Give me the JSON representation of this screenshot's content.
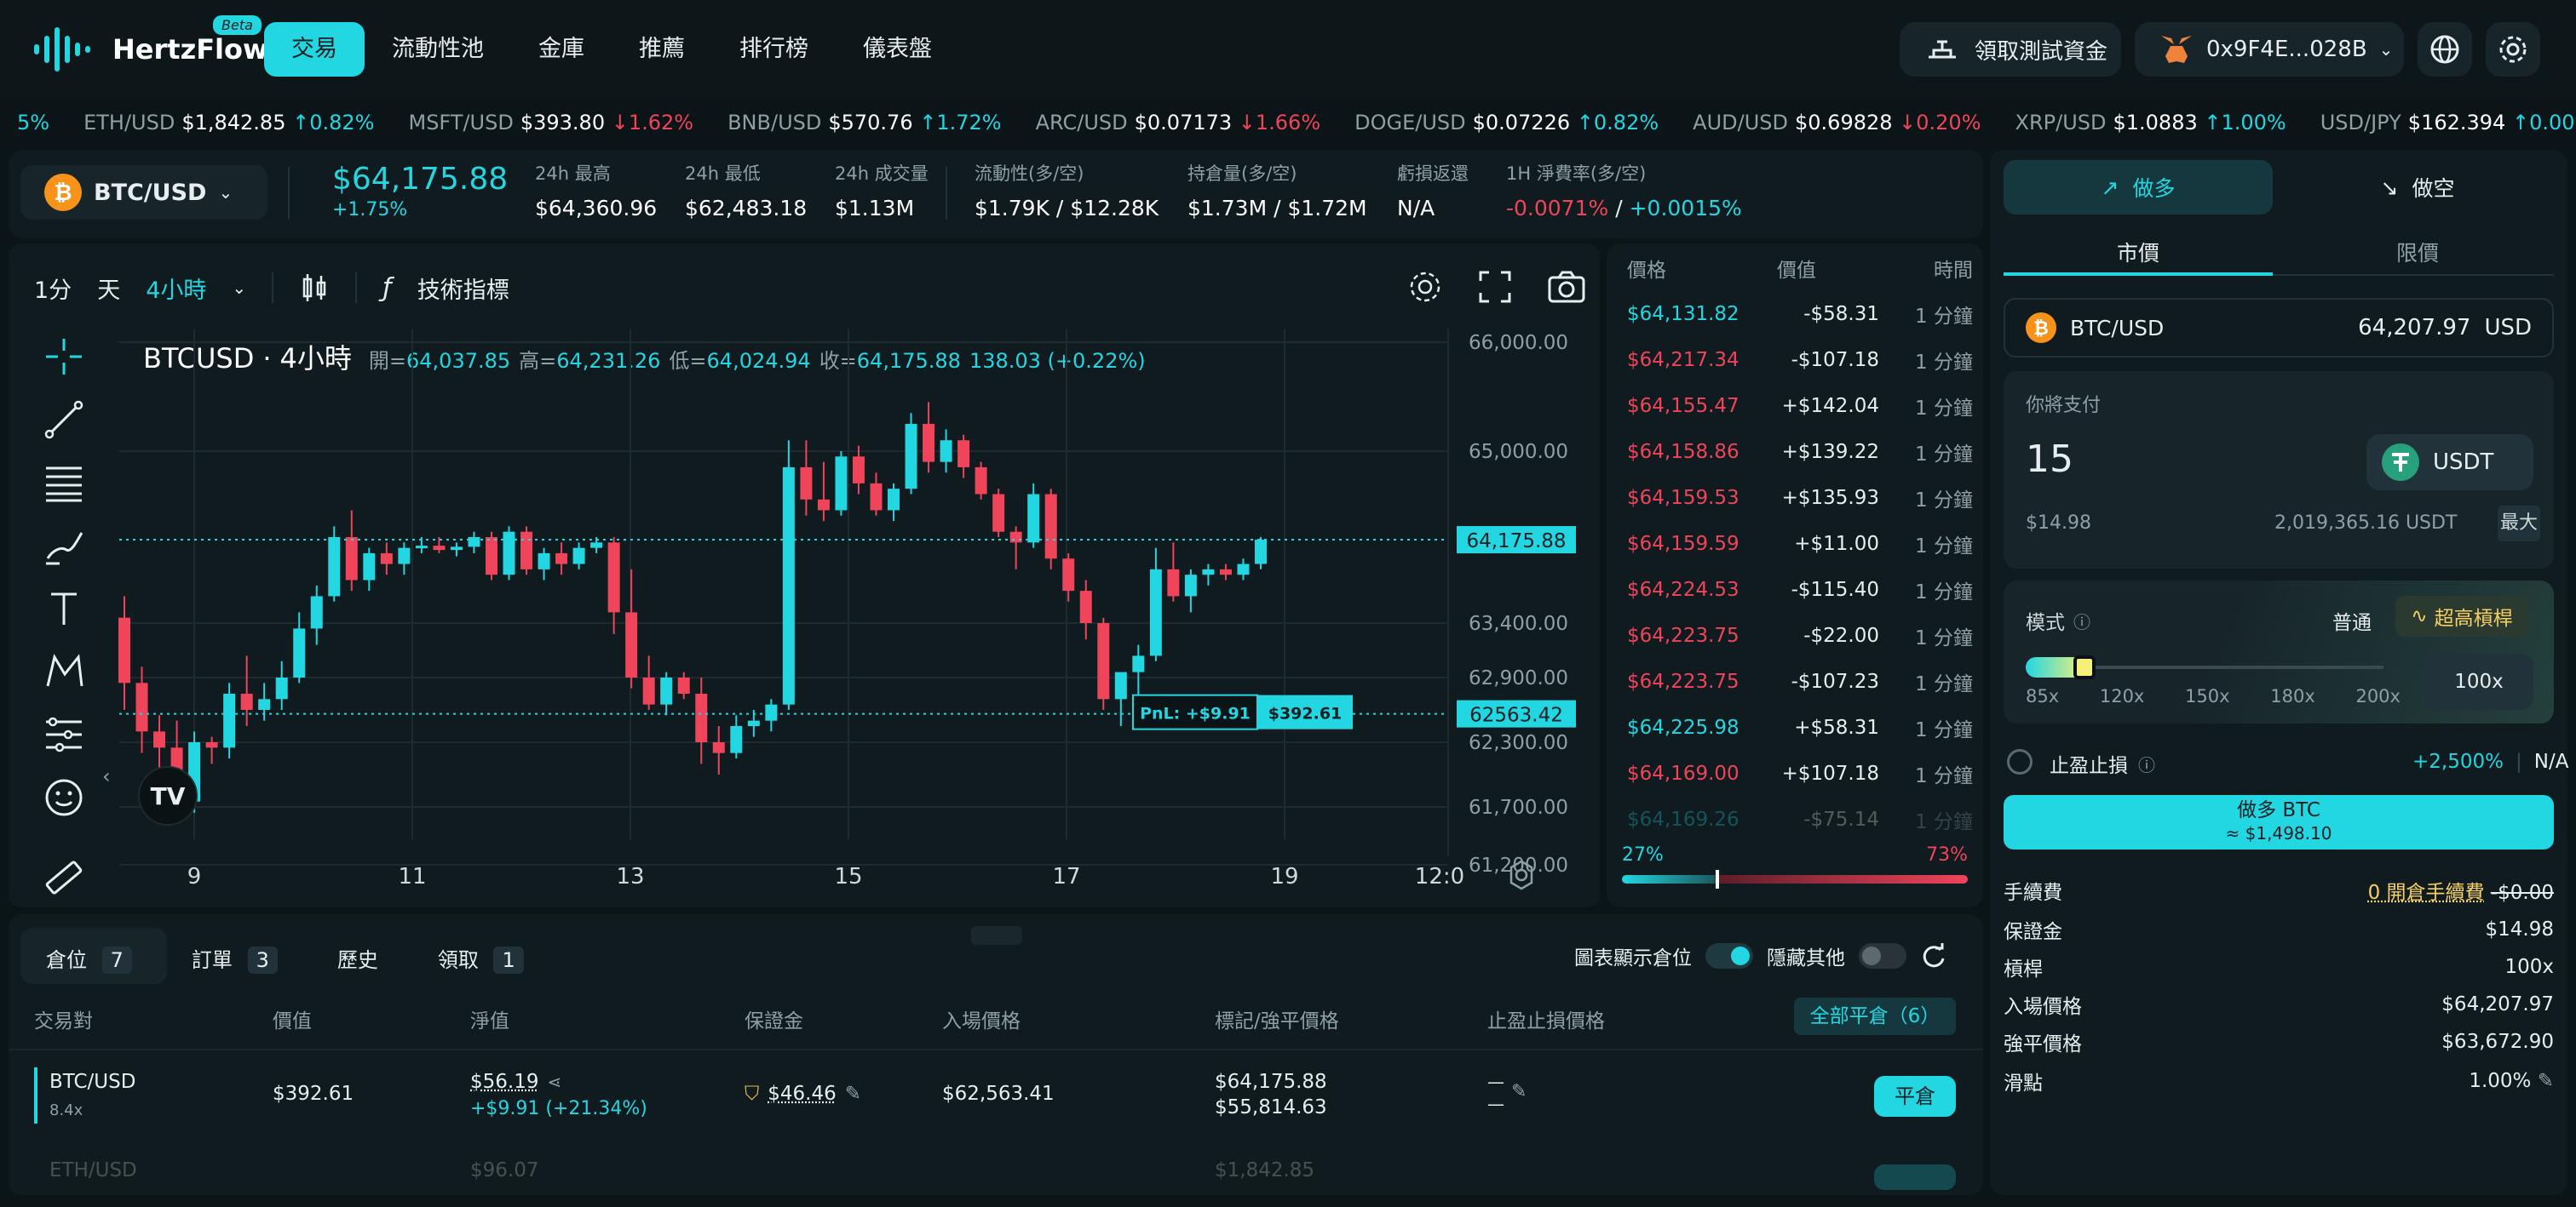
{
  "brand": {
    "name": "HertzFlow",
    "badge": "Beta"
  },
  "nav": {
    "items": [
      "交易",
      "流動性池",
      "金庫",
      "推薦",
      "排行榜",
      "儀表盤"
    ],
    "faucet": "領取測試資金",
    "wallet": "0x9F4E...028B"
  },
  "ticker": [
    {
      "sym": "",
      "price": "",
      "chg": "5%",
      "dir": "up"
    },
    {
      "sym": "ETH/USD",
      "price": "$1,842.85",
      "chg": "↑0.82%",
      "dir": "up"
    },
    {
      "sym": "MSFT/USD",
      "price": "$393.80",
      "chg": "↓1.62%",
      "dir": "dn"
    },
    {
      "sym": "BNB/USD",
      "price": "$570.76",
      "chg": "↑1.72%",
      "dir": "up"
    },
    {
      "sym": "ARC/USD",
      "price": "$0.07173",
      "chg": "↓1.66%",
      "dir": "dn"
    },
    {
      "sym": "DOGE/USD",
      "price": "$0.07226",
      "chg": "↑0.82%",
      "dir": "up"
    },
    {
      "sym": "AUD/USD",
      "price": "$0.69828",
      "chg": "↓0.20%",
      "dir": "dn"
    },
    {
      "sym": "XRP/USD",
      "price": "$1.0883",
      "chg": "↑1.00%",
      "dir": "up"
    },
    {
      "sym": "USD/JPY",
      "price": "$162.394",
      "chg": "↑0.00%",
      "dir": "up"
    }
  ],
  "market": {
    "pair": "BTC/USD",
    "price": "$64,175.88",
    "change": "+1.75%",
    "stats": [
      {
        "label": "24h 最高",
        "value": "$64,360.96"
      },
      {
        "label": "24h 最低",
        "value": "$62,483.18"
      },
      {
        "label": "24h 成交量",
        "value": "$1.13M"
      },
      {
        "label": "流動性(多/空)",
        "value": "$1.79K / $12.28K"
      },
      {
        "label": "持倉量(多/空)",
        "value": "$1.73M / $1.72M"
      },
      {
        "label": "虧損返還",
        "value": "N/A"
      }
    ],
    "funding_label": "1H 淨費率(多/空)",
    "funding_long": "-0.0071%",
    "funding_sep": " / ",
    "funding_short": "+0.0015%"
  },
  "chart_toolbar": {
    "tf1": "1分",
    "tf2": "天",
    "tf3": "4小時",
    "indicators": "技術指標"
  },
  "chart_legend": {
    "symbol": "BTCUSD",
    "interval": "4小時",
    "open_label": "開=",
    "open": "64,037.85",
    "high_label": "高=",
    "high": "64,231.26",
    "low_label": "低=",
    "low": "64,024.94",
    "close_label": "收=",
    "close": "64,175.88",
    "change": "138.03 (+0.22%)"
  },
  "chart_data": {
    "type": "candlestick",
    "title": "BTCUSD · 4小時",
    "x_ticks": [
      "9",
      "11",
      "13",
      "15",
      "17",
      "19",
      "12:0"
    ],
    "y_ticks": [
      66000,
      65000,
      63400,
      62900,
      62300,
      61700,
      61200
    ],
    "y_tick_labels": [
      "66,000.00",
      "65,000.00",
      "63,400.00",
      "62,900.00",
      "62,300.00",
      "61,700.00",
      "61,200.00"
    ],
    "last_price": 64175.88,
    "last_price_label": "64,175.88",
    "entry_price": 62563.42,
    "entry_price_label": "62563.42",
    "pnl_label": "PnL: +$9.91",
    "pnl_value": "$392.61",
    "candles": [
      [
        63450,
        63650,
        62600,
        62850
      ],
      [
        62850,
        63000,
        62200,
        62400
      ],
      [
        62400,
        62550,
        61900,
        62250
      ],
      [
        62250,
        62500,
        61650,
        61750
      ],
      [
        61750,
        62400,
        61650,
        62300
      ],
      [
        62300,
        62350,
        62100,
        62250
      ],
      [
        62250,
        62850,
        62150,
        62750
      ],
      [
        62750,
        63100,
        62450,
        62600
      ],
      [
        62600,
        62850,
        62500,
        62700
      ],
      [
        62700,
        63050,
        62600,
        62900
      ],
      [
        62900,
        63500,
        62850,
        63350
      ],
      [
        63350,
        63750,
        63200,
        63650
      ],
      [
        63650,
        64300,
        63600,
        64200
      ],
      [
        64200,
        64450,
        63700,
        63800
      ],
      [
        63800,
        64100,
        63700,
        64050
      ],
      [
        64050,
        64150,
        63850,
        63950
      ],
      [
        63950,
        64150,
        63850,
        64100
      ],
      [
        64100,
        64200,
        64050,
        64120
      ],
      [
        64120,
        64200,
        64050,
        64080
      ],
      [
        64080,
        64150,
        64020,
        64110
      ],
      [
        64110,
        64250,
        64050,
        64200
      ],
      [
        64200,
        64250,
        63800,
        63850
      ],
      [
        63850,
        64300,
        63800,
        64250
      ],
      [
        64250,
        64300,
        63850,
        63900
      ],
      [
        63900,
        64100,
        63800,
        64050
      ],
      [
        64050,
        64150,
        63850,
        63950
      ],
      [
        63950,
        64150,
        63900,
        64100
      ],
      [
        64100,
        64200,
        64050,
        64150
      ],
      [
        64150,
        64200,
        63300,
        63500
      ],
      [
        63500,
        63900,
        62800,
        62900
      ],
      [
        62900,
        63100,
        62600,
        62650
      ],
      [
        62650,
        62950,
        62550,
        62900
      ],
      [
        62900,
        62950,
        62700,
        62750
      ],
      [
        62750,
        62900,
        62100,
        62300
      ],
      [
        62300,
        62450,
        62000,
        62200
      ],
      [
        62200,
        62550,
        62150,
        62450
      ],
      [
        62450,
        62600,
        62350,
        62500
      ],
      [
        62500,
        62700,
        62400,
        62650
      ],
      [
        62650,
        65100,
        62600,
        64850
      ],
      [
        64850,
        65100,
        64400,
        64550
      ],
      [
        64550,
        64900,
        64350,
        64450
      ],
      [
        64450,
        65000,
        64400,
        64950
      ],
      [
        64950,
        65050,
        64600,
        64700
      ],
      [
        64700,
        64800,
        64400,
        64450
      ],
      [
        64450,
        64700,
        64350,
        64650
      ],
      [
        64650,
        65350,
        64600,
        65250
      ],
      [
        65250,
        65450,
        64800,
        64900
      ],
      [
        64900,
        65200,
        64800,
        65100
      ],
      [
        65100,
        65150,
        64750,
        64850
      ],
      [
        64850,
        64900,
        64550,
        64600
      ],
      [
        64600,
        64650,
        64200,
        64250
      ],
      [
        64250,
        64300,
        63900,
        64150
      ],
      [
        64150,
        64700,
        64100,
        64600
      ],
      [
        64600,
        64650,
        63900,
        64000
      ],
      [
        64000,
        64050,
        63600,
        63700
      ],
      [
        63700,
        63800,
        63250,
        63400
      ],
      [
        63400,
        63450,
        62600,
        62700
      ],
      [
        62700,
        62800,
        62450,
        62950
      ],
      [
        62950,
        63200,
        62700,
        63100
      ],
      [
        63100,
        64100,
        63050,
        63900
      ],
      [
        63900,
        64150,
        63600,
        63650
      ],
      [
        63650,
        63900,
        63500,
        63850
      ],
      [
        63850,
        63950,
        63750,
        63900
      ],
      [
        63900,
        63950,
        63800,
        63850
      ],
      [
        63850,
        64000,
        63800,
        63950
      ],
      [
        63950,
        64200,
        63900,
        64175.88
      ]
    ]
  },
  "orderbook": {
    "headers": [
      "價格",
      "價值",
      "時間"
    ],
    "rows": [
      {
        "price": "$64,131.82",
        "value": "-$58.31",
        "time": "1 分鐘",
        "side": "buy"
      },
      {
        "price": "$64,217.34",
        "value": "-$107.18",
        "time": "1 分鐘",
        "side": "sell"
      },
      {
        "price": "$64,155.47",
        "value": "+$142.04",
        "time": "1 分鐘",
        "side": "sell"
      },
      {
        "price": "$64,158.86",
        "value": "+$139.22",
        "time": "1 分鐘",
        "side": "sell"
      },
      {
        "price": "$64,159.53",
        "value": "+$135.93",
        "time": "1 分鐘",
        "side": "sell"
      },
      {
        "price": "$64,159.59",
        "value": "+$11.00",
        "time": "1 分鐘",
        "side": "sell"
      },
      {
        "price": "$64,224.53",
        "value": "-$115.40",
        "time": "1 分鐘",
        "side": "sell"
      },
      {
        "price": "$64,223.75",
        "value": "-$22.00",
        "time": "1 分鐘",
        "side": "sell"
      },
      {
        "price": "$64,223.75",
        "value": "-$107.23",
        "time": "1 分鐘",
        "side": "sell"
      },
      {
        "price": "$64,225.98",
        "value": "+$58.31",
        "time": "1 分鐘",
        "side": "buy"
      },
      {
        "price": "$64,169.00",
        "value": "+$107.18",
        "time": "1 分鐘",
        "side": "sell"
      },
      {
        "price": "$64,169.26",
        "value": "-$75.14",
        "time": "1 分鐘",
        "side": "buy"
      }
    ],
    "long_pct": "27%",
    "short_pct": "73%",
    "long_ratio": 0.27
  },
  "positions": {
    "tabs": [
      {
        "label": "倉位",
        "count": "7"
      },
      {
        "label": "訂單",
        "count": "3"
      },
      {
        "label": "歷史",
        "count": ""
      },
      {
        "label": "領取",
        "count": "1"
      }
    ],
    "show_on_chart": "圖表顯示倉位",
    "hide_others": "隱藏其他",
    "headers": [
      "交易對",
      "價值",
      "淨值",
      "保證金",
      "入場價格",
      "標記/強平價格",
      "止盈止損價格"
    ],
    "close_all": "全部平倉（6）",
    "rows": [
      {
        "pair": "BTC/USD",
        "lev": "8.4x",
        "value": "$392.61",
        "net": "$56.19",
        "pnl": "+$9.91 (+21.34%)",
        "margin": "$46.46",
        "entry": "$62,563.41",
        "mark": "$64,175.88",
        "liq": "$55,814.63",
        "tpsl1": "—",
        "tpsl2": "—",
        "close": "平倉"
      },
      {
        "pair": "ETH/USD",
        "lev": "",
        "value": "",
        "net": "$96.07",
        "pnl": "",
        "margin": "",
        "entry": "",
        "mark": "$1,842.85",
        "liq": "",
        "tpsl1": "",
        "tpsl2": "",
        "close": ""
      }
    ]
  },
  "trade": {
    "long": "做多",
    "short": "做空",
    "tab_market": "市價",
    "tab_limit": "限價",
    "pair": "BTC/USD",
    "pair_price": "64,207.97",
    "pair_ccy": "USD",
    "pay_label": "你將支付",
    "pay_amount": "15",
    "pay_token": "USDT",
    "pay_usd": "$14.98",
    "balance": "2,019,365.16 USDT",
    "max": "最大",
    "mode_label": "模式",
    "mode_normal": "普通",
    "mode_ultra": "超高槓桿",
    "lev_marks": [
      "85x",
      "120x",
      "150x",
      "180x",
      "200x"
    ],
    "lev_value": "100x",
    "lev_fill": 0.0,
    "tpsl": "止盈止損",
    "tpsl_pct": "+2,500%",
    "tpsl_na": "N/A",
    "submit": "做多 BTC",
    "submit_sub": "≈ $1,498.10",
    "fee_label": "手續費",
    "fee_note": "0 開倉手續費",
    "fee_val": "-$0.00",
    "details": [
      {
        "label": "保證金",
        "value": "$14.98"
      },
      {
        "label": "槓桿",
        "value": "100x"
      },
      {
        "label": "入場價格",
        "value": "$64,207.97"
      },
      {
        "label": "強平價格",
        "value": "$63,672.90"
      },
      {
        "label": "滑點",
        "value": "1.00%"
      }
    ]
  },
  "colors": {
    "accent": "#22d6e2",
    "up": "#22d6e2",
    "down": "#f0445b",
    "bg": "#0b1416",
    "panel": "#0f1b1e"
  }
}
